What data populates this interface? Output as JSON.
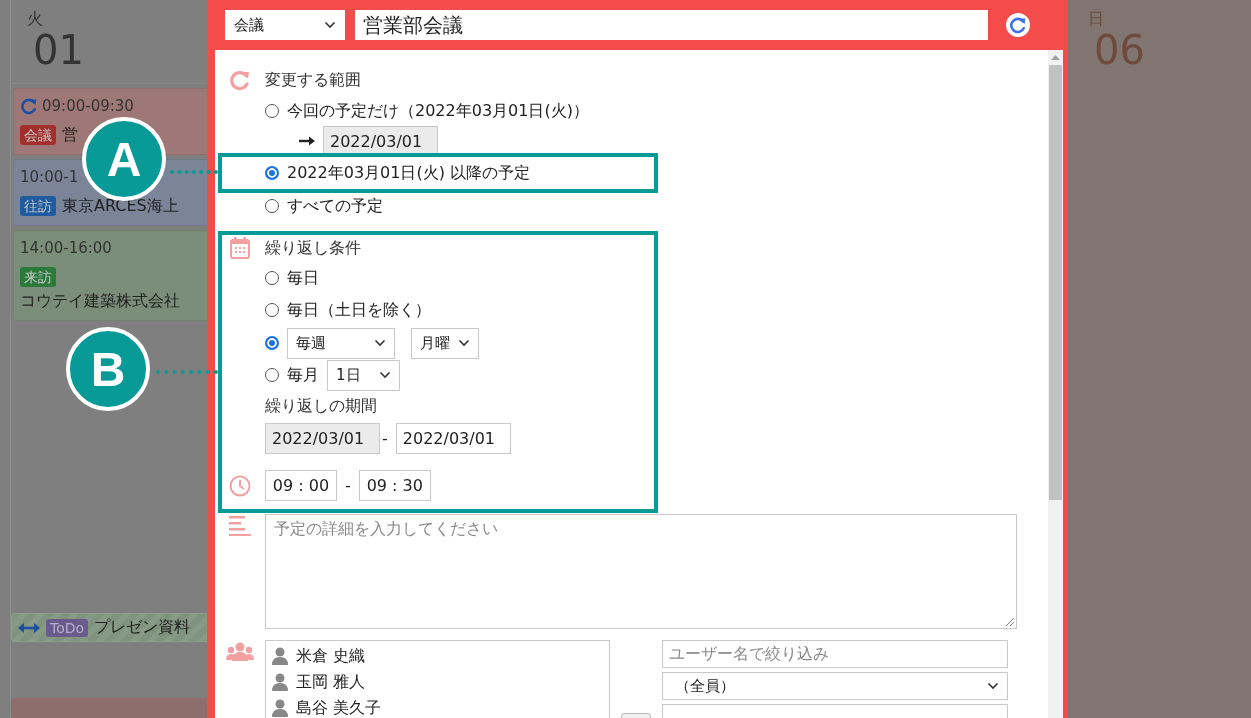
{
  "calendar_left": {
    "weekday": "火",
    "date": "01",
    "events": [
      {
        "recurring": true,
        "time": "09:00-09:30",
        "tag": {
          "text": "会議",
          "color": "#a32f2c"
        },
        "title": "営",
        "color": "#9d7876"
      },
      {
        "recurring": false,
        "time": "10:00-1",
        "tag": {
          "text": "往訪",
          "color": "#1f5b9e"
        },
        "title": "東京ARCES海上",
        "color": "#7b8597"
      },
      {
        "recurring": false,
        "time": "14:00-16:00",
        "tag": {
          "text": "来訪",
          "color": "#2b7a3c"
        },
        "title": "コウテイ建築株式会社",
        "color": "#7b8e79"
      }
    ],
    "todo": {
      "tag": "ToDo",
      "title": "プレゼン資料"
    }
  },
  "calendar_right": {
    "weekday": "日",
    "date": "06"
  },
  "dialog": {
    "category": "会議",
    "title": "営業部会議",
    "scope": {
      "label": "変更する範囲",
      "options": [
        {
          "text": "今回の予定だけ（2022年03月01日(火)）",
          "selected": false
        },
        {
          "text": "2022年03月01日(火) 以降の予定",
          "selected": true
        },
        {
          "text": "すべての予定",
          "selected": false
        }
      ],
      "move_date": "2022/03/01"
    },
    "repeat": {
      "label": "繰り返し条件",
      "options": [
        {
          "kind": "plain",
          "text": "毎日",
          "selected": false
        },
        {
          "kind": "plain",
          "text": "毎日（土日を除く）",
          "selected": false
        },
        {
          "kind": "weekly",
          "selects": [
            "毎週",
            "月曜"
          ],
          "selected": true
        },
        {
          "kind": "monthly",
          "text": "毎月",
          "selects": [
            "1日"
          ],
          "selected": false
        }
      ],
      "period_label": "繰り返しの期間",
      "period": [
        {
          "value": "2022/03/01",
          "readonly": true
        },
        {
          "value": "2022/03/01",
          "readonly": false
        }
      ],
      "period_separator": "-"
    },
    "time": {
      "start": "09 : 00",
      "separator": "-",
      "end": "09 : 30"
    },
    "detail": {
      "placeholder": "予定の詳細を入力してください"
    },
    "members": {
      "selected": [
        "米倉 史織",
        "玉岡 雅人",
        "島谷 美久子"
      ],
      "filter_placeholder": "ユーザー名で絞り込み",
      "group": "（全員）"
    }
  },
  "annotations": [
    {
      "label": "A"
    },
    {
      "label": "B"
    }
  ]
}
